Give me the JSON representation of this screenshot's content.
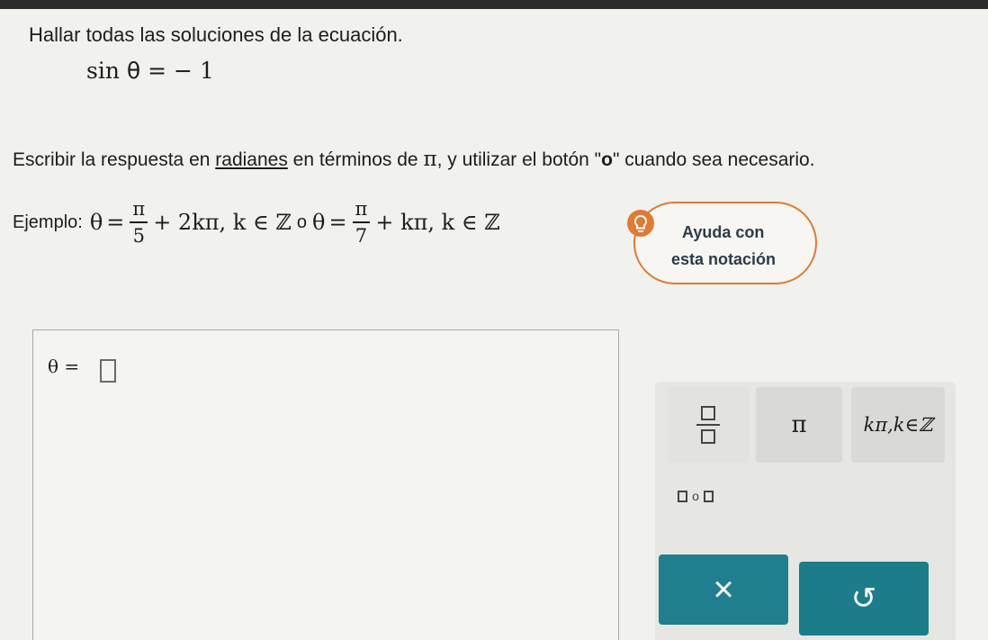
{
  "instruction": "Hallar todas las soluciones de la ecuación.",
  "equation": {
    "lhs_func": "sin",
    "var": "θ",
    "eq": "=",
    "rhs": "− 1"
  },
  "instruction2": {
    "before": "Escribir la respuesta en ",
    "link": "radianes",
    "middle": " en términos de ",
    "pi": "π",
    "after": ", y utilizar el botón \"",
    "o": "o",
    "end": "\" cuando sea necesario."
  },
  "example": {
    "label": "Ejemplo:",
    "theta": "θ",
    "eq": "=",
    "pi": "π",
    "den1": "5",
    "term1": "+ 2kπ, k ∈ ℤ",
    "or": "o",
    "den2": "7",
    "term2": "+ kπ, k ∈ ℤ"
  },
  "help": {
    "line1": "Ayuda con",
    "line2": "esta notación",
    "icon": "lightbulb-icon",
    "accent": "#e07a34"
  },
  "answer": {
    "label": "θ ="
  },
  "keypad": {
    "pi_label": "π",
    "kpi_label": "kπ,k∈ℤ",
    "or_label": "o",
    "clear_label": "×",
    "undo_label": "↺",
    "accent": "#1f7f8e"
  }
}
